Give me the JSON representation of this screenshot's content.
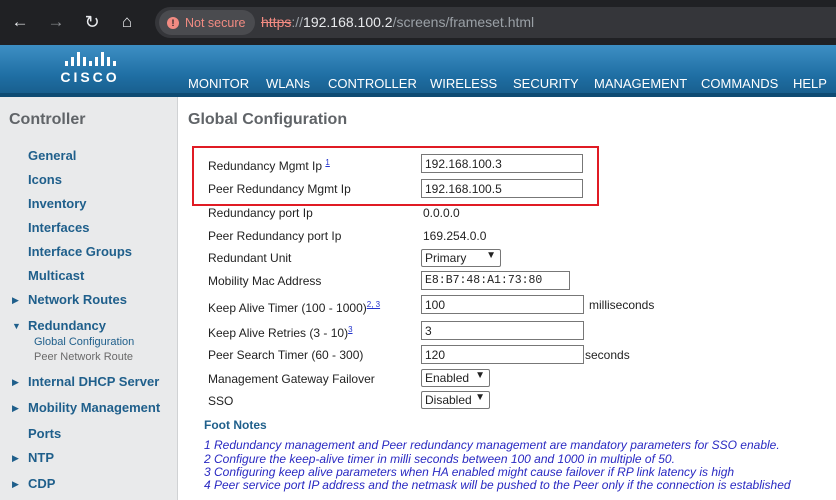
{
  "browser": {
    "security_label": "Not secure",
    "url_scheme": "https",
    "url_sep": "://",
    "url_host": "192.168.100.2",
    "url_path": "/screens/frameset.html"
  },
  "brand": {
    "logo_text": "CISCO"
  },
  "menu": [
    "MONITOR",
    "WLANs",
    "CONTROLLER",
    "WIRELESS",
    "SECURITY",
    "MANAGEMENT",
    "COMMANDS",
    "HELP"
  ],
  "menu_active": "CONTROLLER",
  "sidebar": {
    "title": "Controller",
    "items": [
      "General",
      "Icons",
      "Inventory",
      "Interfaces",
      "Interface Groups",
      "Multicast",
      "Network Routes",
      "Redundancy",
      "Internal DHCP Server",
      "Mobility Management",
      "Ports",
      "NTP",
      "CDP"
    ],
    "sub_items": [
      "Global Configuration",
      "Peer Network Route"
    ]
  },
  "page": {
    "title": "Global Configuration",
    "fields": {
      "redundancy_mgmt_ip": {
        "label": "Redundancy Mgmt Ip",
        "sup": "1",
        "value": "192.168.100.3"
      },
      "peer_redundancy_mgmt_ip": {
        "label": "Peer Redundancy Mgmt Ip",
        "value": "192.168.100.5"
      },
      "redundancy_port_ip": {
        "label": "Redundancy port Ip",
        "value": "0.0.0.0"
      },
      "peer_redundancy_port_ip": {
        "label": "Peer Redundancy port Ip",
        "value": "169.254.0.0"
      },
      "redundant_unit": {
        "label": "Redundant Unit",
        "value": "Primary"
      },
      "mobility_mac": {
        "label": "Mobility Mac Address",
        "value": "E8:B7:48:A1:73:80"
      },
      "keep_alive_timer": {
        "label": "Keep Alive Timer (100 - 1000)",
        "sup": "2, 3",
        "value": "100",
        "unit": "milliseconds"
      },
      "keep_alive_retries": {
        "label": "Keep Alive Retries (3 - 10)",
        "sup": "3",
        "value": "3"
      },
      "peer_search_timer": {
        "label": "Peer Search Timer (60 - 300)",
        "value": "120",
        "unit": "seconds"
      },
      "mgmt_gateway_failover": {
        "label": "Management Gateway Failover",
        "value": "Enabled"
      },
      "sso": {
        "label": "SSO",
        "value": "Disabled"
      }
    },
    "foot_title": "Foot Notes",
    "foot_notes": [
      "1 Redundancy management and Peer redundancy management are mandatory parameters for SSO enable.",
      "2 Configure the keep-alive timer in milli seconds between 100 and 1000 in multiple of 50.",
      "3 Configuring keep alive parameters when HA enabled might cause failover if RP link latency is high",
      "4 Peer service port IP address and the netmask will be pushed to the Peer only if the connection is established"
    ]
  }
}
